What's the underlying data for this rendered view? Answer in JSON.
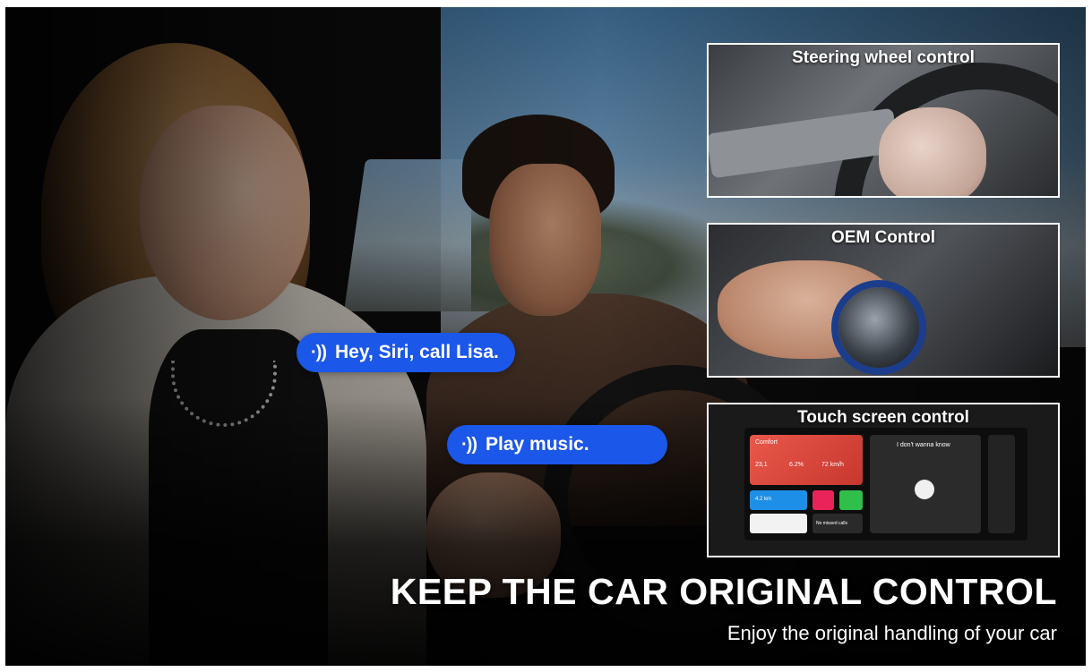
{
  "bubbles": [
    {
      "icon": "voice-wave-icon",
      "glyph": "·))",
      "text": "Hey, Siri, call Lisa."
    },
    {
      "icon": "voice-wave-icon",
      "glyph": "·))",
      "text": "Play music."
    }
  ],
  "panels": [
    {
      "title": "Steering wheel control"
    },
    {
      "title": "OEM Control"
    },
    {
      "title": "Touch screen control"
    }
  ],
  "screen": {
    "tile_title": "Comfort",
    "stats": [
      "23,1",
      "6.2%",
      "72 km/h"
    ],
    "nav": "4.2 km",
    "calls": "No missed calls",
    "song": "I don't wanna know"
  },
  "headline": "KEEP THE CAR ORIGINAL CONTROL",
  "subline": "Enjoy the original handling of your car",
  "colors": {
    "bubble": "#1b57e8",
    "panel_border": "#ffffff",
    "text": "#ffffff"
  }
}
